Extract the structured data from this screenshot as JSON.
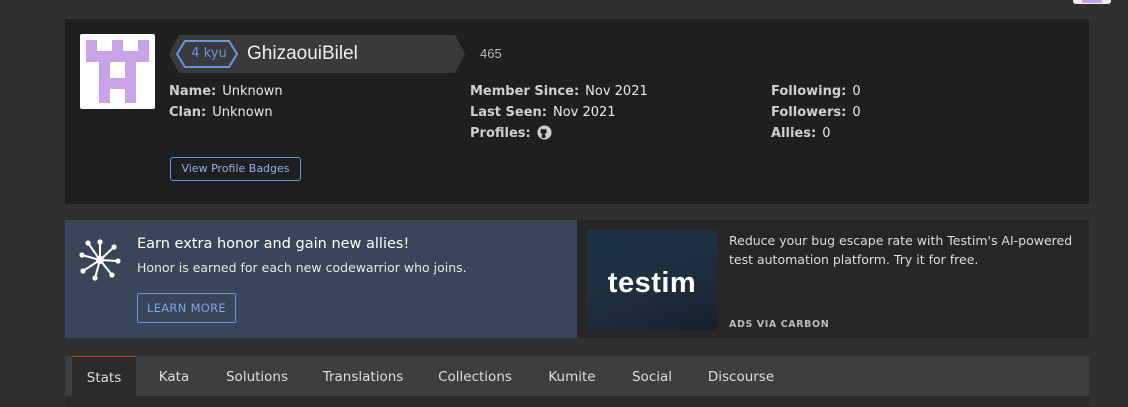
{
  "profile": {
    "rank": "4 kyu",
    "username": "GhizaouiBilel",
    "honor": "465",
    "fields_left": [
      {
        "label": "Name:",
        "value": "Unknown"
      },
      {
        "label": "Clan:",
        "value": "Unknown"
      }
    ],
    "fields_middle": [
      {
        "label": "Member Since:",
        "value": "Nov 2021"
      },
      {
        "label": "Last Seen:",
        "value": "Nov 2021"
      },
      {
        "label": "Profiles:",
        "icon": "github-icon"
      }
    ],
    "fields_right": [
      {
        "label": "Following:",
        "value": "0"
      },
      {
        "label": "Followers:",
        "value": "0"
      },
      {
        "label": "Allies:",
        "value": "0"
      }
    ],
    "badges_button": "View Profile Badges",
    "colors": {
      "rank_blue": "#6795de",
      "avatar_purple": "#c9a3e6"
    }
  },
  "allies_banner": {
    "icon": "network-icon",
    "title": "Earn extra honor and gain new allies!",
    "subtitle": "Honor is earned for each new codewarrior who joins.",
    "button": "LEARN MORE"
  },
  "ad": {
    "logo_text": "testim",
    "text": "Reduce your bug escape rate with Testim's AI-powered test automation platform. Try it for free.",
    "via": "ADS VIA CARBON"
  },
  "tabs": [
    {
      "label": "Stats",
      "active": true
    },
    {
      "label": "Kata"
    },
    {
      "label": "Solutions"
    },
    {
      "label": "Translations"
    },
    {
      "label": "Collections"
    },
    {
      "label": "Kumite"
    },
    {
      "label": "Social"
    },
    {
      "label": "Discourse"
    }
  ]
}
